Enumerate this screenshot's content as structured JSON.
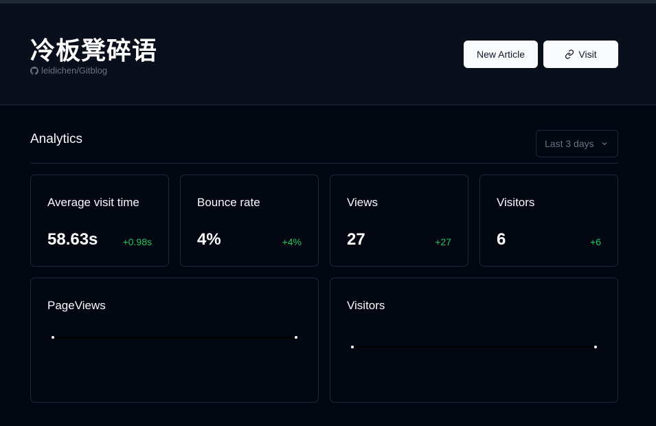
{
  "header": {
    "site_title": "冷板凳碎语",
    "repo": "leidichen/Gitblog",
    "new_article_label": "New Article",
    "visit_label": "Visit"
  },
  "analytics": {
    "title": "Analytics",
    "range_selected": "Last 3 days",
    "stats": [
      {
        "label": "Average visit time",
        "value": "58.63s",
        "delta": "+0.98s"
      },
      {
        "label": "Bounce rate",
        "value": "4%",
        "delta": "+4%"
      },
      {
        "label": "Views",
        "value": "27",
        "delta": "+27"
      },
      {
        "label": "Visitors",
        "value": "6",
        "delta": "+6"
      }
    ],
    "charts": [
      {
        "label": "PageViews"
      },
      {
        "label": "Visitors"
      }
    ]
  },
  "colors": {
    "background": "#030712",
    "header_bg": "#0a0f1c",
    "border": "#1e293b",
    "positive": "#22c55e",
    "button_bg": "#f8fafc"
  },
  "chart_data": [
    {
      "type": "line",
      "series": [
        {
          "values": [
            0,
            0
          ]
        }
      ]
    },
    {
      "type": "line",
      "series": [
        {
          "values": [
            0,
            0
          ]
        }
      ]
    }
  ]
}
